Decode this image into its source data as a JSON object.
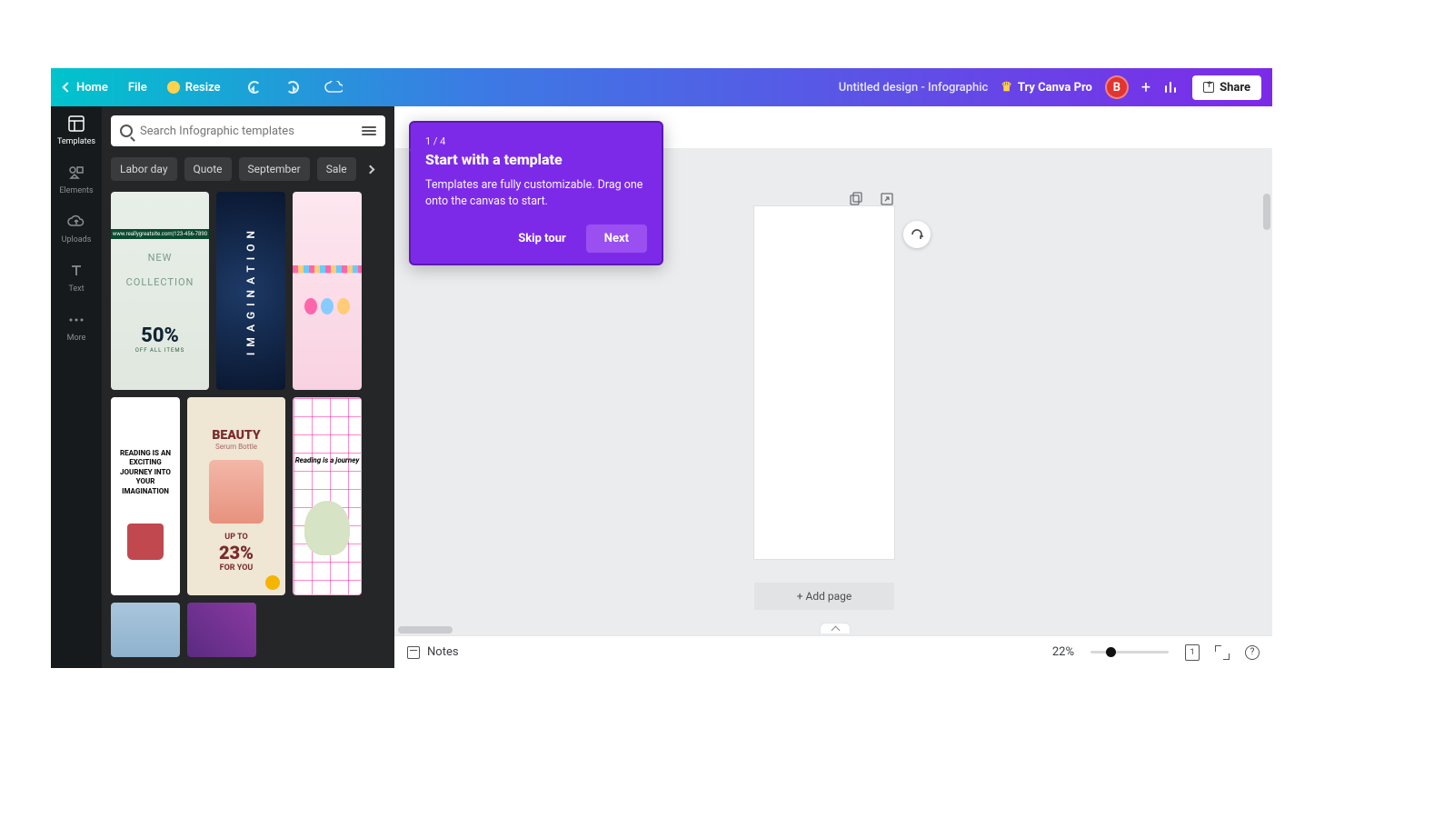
{
  "topbar": {
    "home": "Home",
    "file": "File",
    "resize": "Resize",
    "doc_title": "Untitled design - Infographic",
    "try_pro": "Try Canva Pro",
    "avatar_initial": "B",
    "share": "Share"
  },
  "rail": {
    "templates": "Templates",
    "elements": "Elements",
    "uploads": "Uploads",
    "text": "Text",
    "more": "More"
  },
  "panel": {
    "search_placeholder": "Search Infographic templates",
    "chips": [
      "Labor day",
      "Quote",
      "September",
      "Sale"
    ],
    "t1": {
      "header": "www.reallygreatsite.com|123-456-7890",
      "line1": "NEW",
      "line2": "COLLECTION",
      "pct": "50%",
      "off": "OFF ALL ITEMS"
    },
    "t2": {
      "word": "IMAGINATION"
    },
    "t4": {
      "text": "READING IS AN EXCITING JOURNEY INTO YOUR IMAGINATION"
    },
    "t5": {
      "title": "BEAUTY",
      "sub": "Serum Bottle",
      "up": "UP TO",
      "pct": "23%",
      "for": "FOR YOU"
    },
    "t6": {
      "text": "Reading is a journey"
    }
  },
  "tour": {
    "step": "1 / 4",
    "title": "Start with a template",
    "body": "Templates are fully customizable. Drag one onto the canvas to start.",
    "skip": "Skip tour",
    "next": "Next"
  },
  "canvas": {
    "add_page": "+ Add page"
  },
  "bottombar": {
    "notes": "Notes",
    "zoom": "22%",
    "zoom_pos_pct": 22,
    "page_badge": "1",
    "help": "?"
  }
}
